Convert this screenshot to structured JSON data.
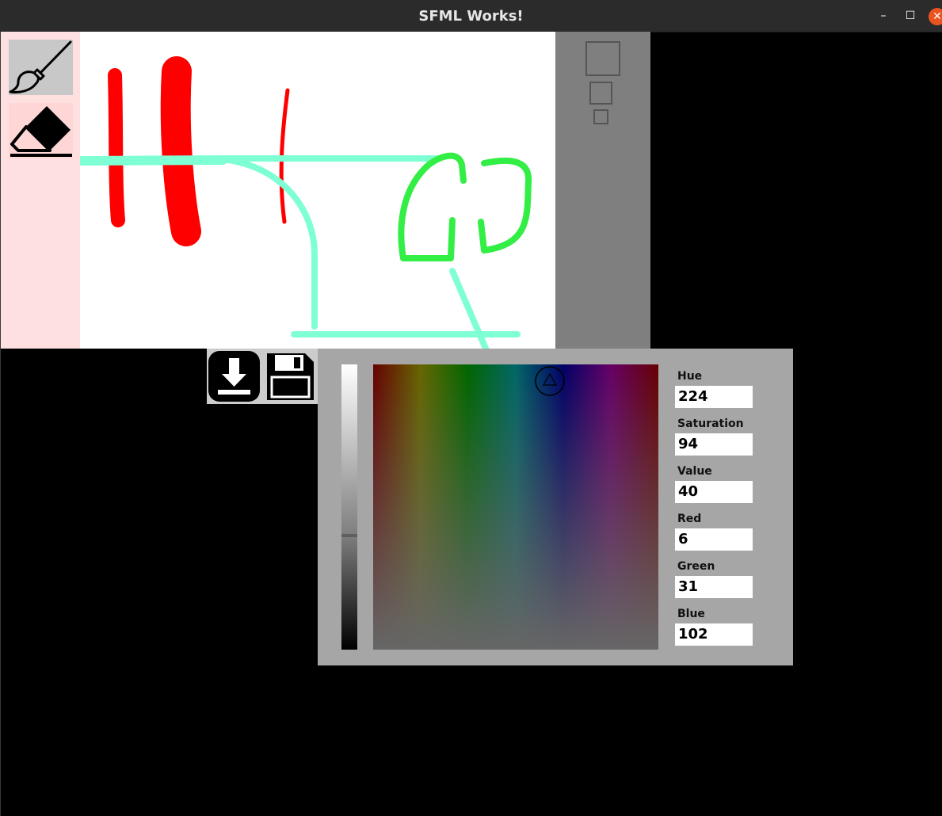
{
  "window": {
    "title": "SFML Works!",
    "controls": {
      "minimize": "–",
      "maximize": "☐",
      "close": "✕"
    }
  },
  "colors": {
    "toolbar_bg": "#ffe0e0",
    "tool_selected_bg": "#c8c8c8",
    "tool_bg": "#ffd6d6",
    "size_panel_bg": "#7f7f7f",
    "picker_bg": "#a6a6a6",
    "stroke_red": "#ff0000",
    "stroke_aqua": "#7fffd4",
    "stroke_green": "#33ee44"
  },
  "tools": [
    {
      "name": "brush",
      "icon": "paintbrush-icon",
      "selected": true
    },
    {
      "name": "eraser",
      "icon": "eraser-icon",
      "selected": false
    }
  ],
  "brush_sizes": [
    "large",
    "medium",
    "small"
  ],
  "file_buttons": [
    {
      "name": "load",
      "icon": "download-icon"
    },
    {
      "name": "save",
      "icon": "floppy-disk-icon"
    }
  ],
  "color_picker": {
    "hue_label": "Hue",
    "hue": "224",
    "saturation_label": "Saturation",
    "saturation": "94",
    "value_label": "Value",
    "value": "40",
    "red_label": "Red",
    "red": "6",
    "green_label": "Green",
    "green": "31",
    "blue_label": "Blue",
    "blue": "102"
  }
}
